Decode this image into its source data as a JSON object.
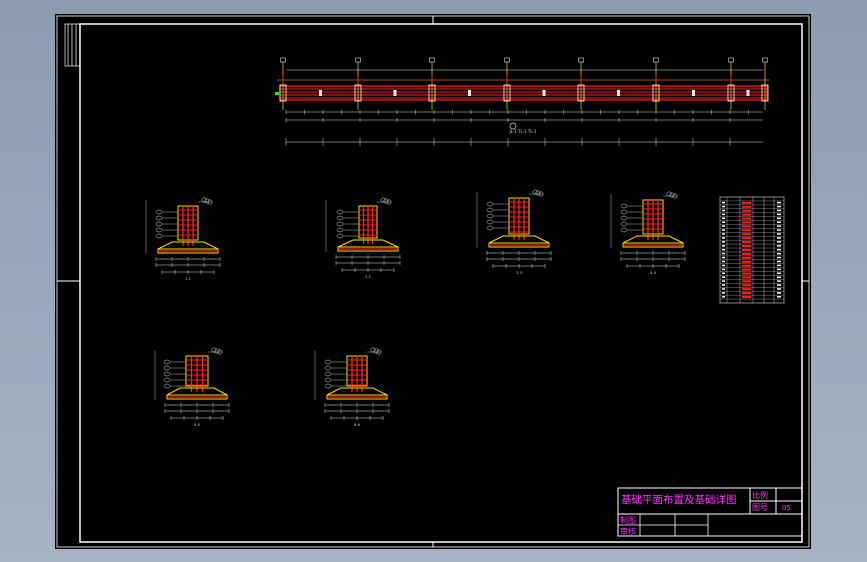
{
  "drawing": {
    "plan_caption": "JL-1 TL-1 TL-1",
    "section_labels": [
      "1-1",
      "2-2",
      "3-3",
      "4-4",
      "5-5",
      "6-6"
    ]
  },
  "title_block": {
    "title": "基础平面布置及基础详图",
    "scale_label": "比例",
    "drawing_no_label": "图号",
    "drawing_no_value": "05",
    "drawn_label": "制图",
    "checked_label": "审核"
  },
  "colors": {
    "background": "#000000",
    "frame": "#ffffff",
    "rebar": "#ff2020",
    "footing": "#ffe000",
    "title_text": "#ff33ff",
    "cad_bg": "#98a6ba"
  }
}
